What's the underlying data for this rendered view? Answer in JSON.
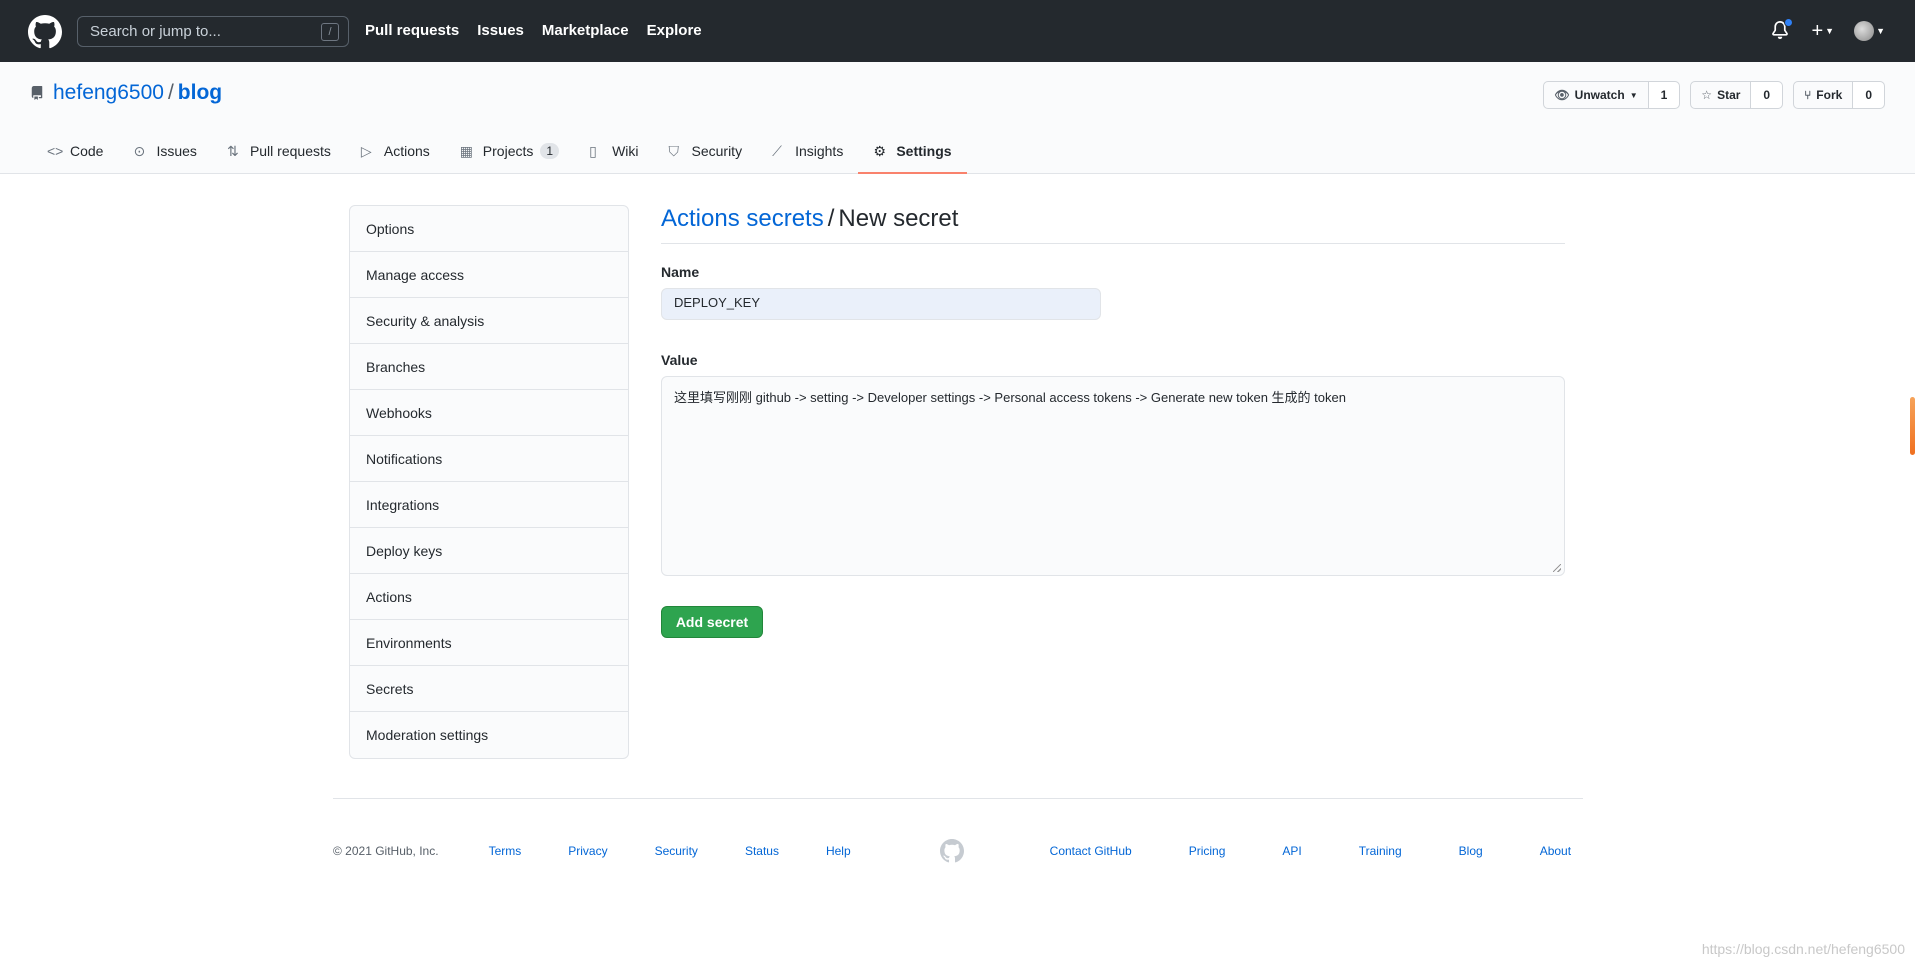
{
  "header": {
    "search_placeholder": "Search or jump to...",
    "search_shortcut": "/",
    "nav": [
      "Pull requests",
      "Issues",
      "Marketplace",
      "Explore"
    ],
    "notification_unread": true
  },
  "repo": {
    "owner": "hefeng6500",
    "separator": "/",
    "name": "blog",
    "actions": {
      "watch": {
        "label": "Unwatch",
        "count": "1"
      },
      "star": {
        "label": "Star",
        "count": "0"
      },
      "fork": {
        "label": "Fork",
        "count": "0"
      }
    },
    "tabs": [
      {
        "label": "Code",
        "icon": "code-icon"
      },
      {
        "label": "Issues",
        "icon": "issue-icon"
      },
      {
        "label": "Pull requests",
        "icon": "pull-request-icon"
      },
      {
        "label": "Actions",
        "icon": "play-icon"
      },
      {
        "label": "Projects",
        "icon": "project-icon",
        "counter": "1"
      },
      {
        "label": "Wiki",
        "icon": "book-icon"
      },
      {
        "label": "Security",
        "icon": "shield-icon"
      },
      {
        "label": "Insights",
        "icon": "graph-icon"
      },
      {
        "label": "Settings",
        "icon": "gear-icon",
        "selected": true
      }
    ]
  },
  "sidebar": {
    "items": [
      "Options",
      "Manage access",
      "Security & analysis",
      "Branches",
      "Webhooks",
      "Notifications",
      "Integrations",
      "Deploy keys",
      "Actions",
      "Environments",
      "Secrets",
      "Moderation settings"
    ]
  },
  "main": {
    "breadcrumb_link": "Actions secrets",
    "breadcrumb_sep": "/",
    "title": "New secret",
    "name_label": "Name",
    "name_value": "DEPLOY_KEY",
    "value_label": "Value",
    "value_text": "这里填写刚刚 github -> setting -> Developer settings -> Personal access tokens -> Generate new token 生成的 token",
    "submit_label": "Add secret"
  },
  "footer": {
    "copyright": "© 2021 GitHub, Inc.",
    "left_links": [
      "Terms",
      "Privacy",
      "Security",
      "Status",
      "Help"
    ],
    "right_links": [
      "Contact GitHub",
      "Pricing",
      "API",
      "Training",
      "Blog",
      "About"
    ]
  },
  "watermark": "https://blog.csdn.net/hefeng6500",
  "colors": {
    "header_bg": "#24292e",
    "link": "#0366d6",
    "primary_button": "#2ea44f",
    "selected_tab_underline": "#f9826c"
  }
}
